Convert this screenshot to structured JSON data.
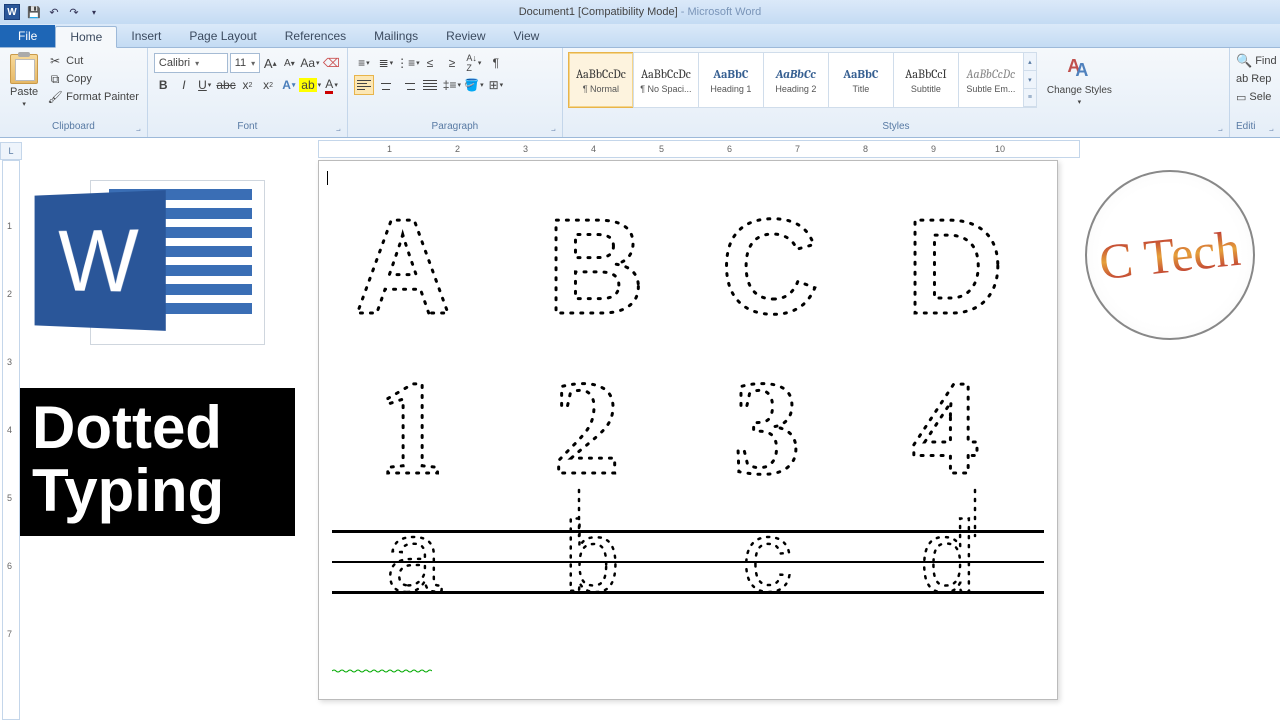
{
  "titlebar": {
    "doc": "Document1 [Compatibility Mode]",
    "app": "Microsoft Word"
  },
  "tabs": {
    "file": "File",
    "home": "Home",
    "insert": "Insert",
    "pagelayout": "Page Layout",
    "references": "References",
    "mailings": "Mailings",
    "review": "Review",
    "view": "View"
  },
  "clipboard": {
    "paste": "Paste",
    "cut": "Cut",
    "copy": "Copy",
    "format_painter": "Format Painter",
    "label": "Clipboard"
  },
  "font": {
    "name": "Calibri",
    "size": "11",
    "label": "Font"
  },
  "paragraph": {
    "label": "Paragraph"
  },
  "styles": {
    "label": "Styles",
    "items": [
      {
        "preview": "AaBbCcDc",
        "name": "¶ Normal"
      },
      {
        "preview": "AaBbCcDc",
        "name": "¶ No Spaci..."
      },
      {
        "preview": "AaBbC",
        "name": "Heading 1"
      },
      {
        "preview": "AaBbCc",
        "name": "Heading 2"
      },
      {
        "preview": "AaBbC",
        "name": "Title"
      },
      {
        "preview": "AaBbCcI",
        "name": "Subtitle"
      },
      {
        "preview": "AaBbCcDc",
        "name": "Subtle Em..."
      }
    ],
    "change": "Change Styles"
  },
  "editing": {
    "find": "Find",
    "replace": "Rep",
    "select": "Sele",
    "label": "Editi"
  },
  "document": {
    "row1": [
      "A",
      "B",
      "C",
      "D"
    ],
    "row2": [
      "1",
      "2",
      "3",
      "4"
    ],
    "trace": [
      "a",
      "b",
      "c",
      "d"
    ]
  },
  "overlay": {
    "caption_l1": "Dotted",
    "caption_l2": "Typing",
    "logo_letter": "W",
    "badge": "C Tech"
  }
}
